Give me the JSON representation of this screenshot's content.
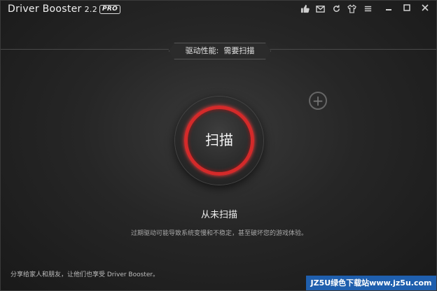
{
  "app": {
    "name": "Driver Booster",
    "version": "2.2",
    "edition": "PRO"
  },
  "title_icons": [
    "thumbs-up-icon",
    "mail-icon",
    "refresh-icon",
    "shirt-icon",
    "menu-icon"
  ],
  "window_controls": [
    "minimize",
    "maximize",
    "close"
  ],
  "status_bar": {
    "label": "驱动性能:",
    "value": "需要扫描"
  },
  "scan": {
    "button_label": "扫描",
    "status": "从未扫描",
    "description": "过期驱动可能导致系统变慢和不稳定，甚至破坏您的游戏体验。"
  },
  "footer": {
    "share_text": "分享给家人和朋友，让他们也享受 Driver Booster。",
    "watermark": "JZ5U绿色下载站www.jz5u.com"
  },
  "colors": {
    "accent_red": "#d42a2a",
    "background": "#1a1a1a",
    "watermark_bg": "#1f5fae"
  }
}
